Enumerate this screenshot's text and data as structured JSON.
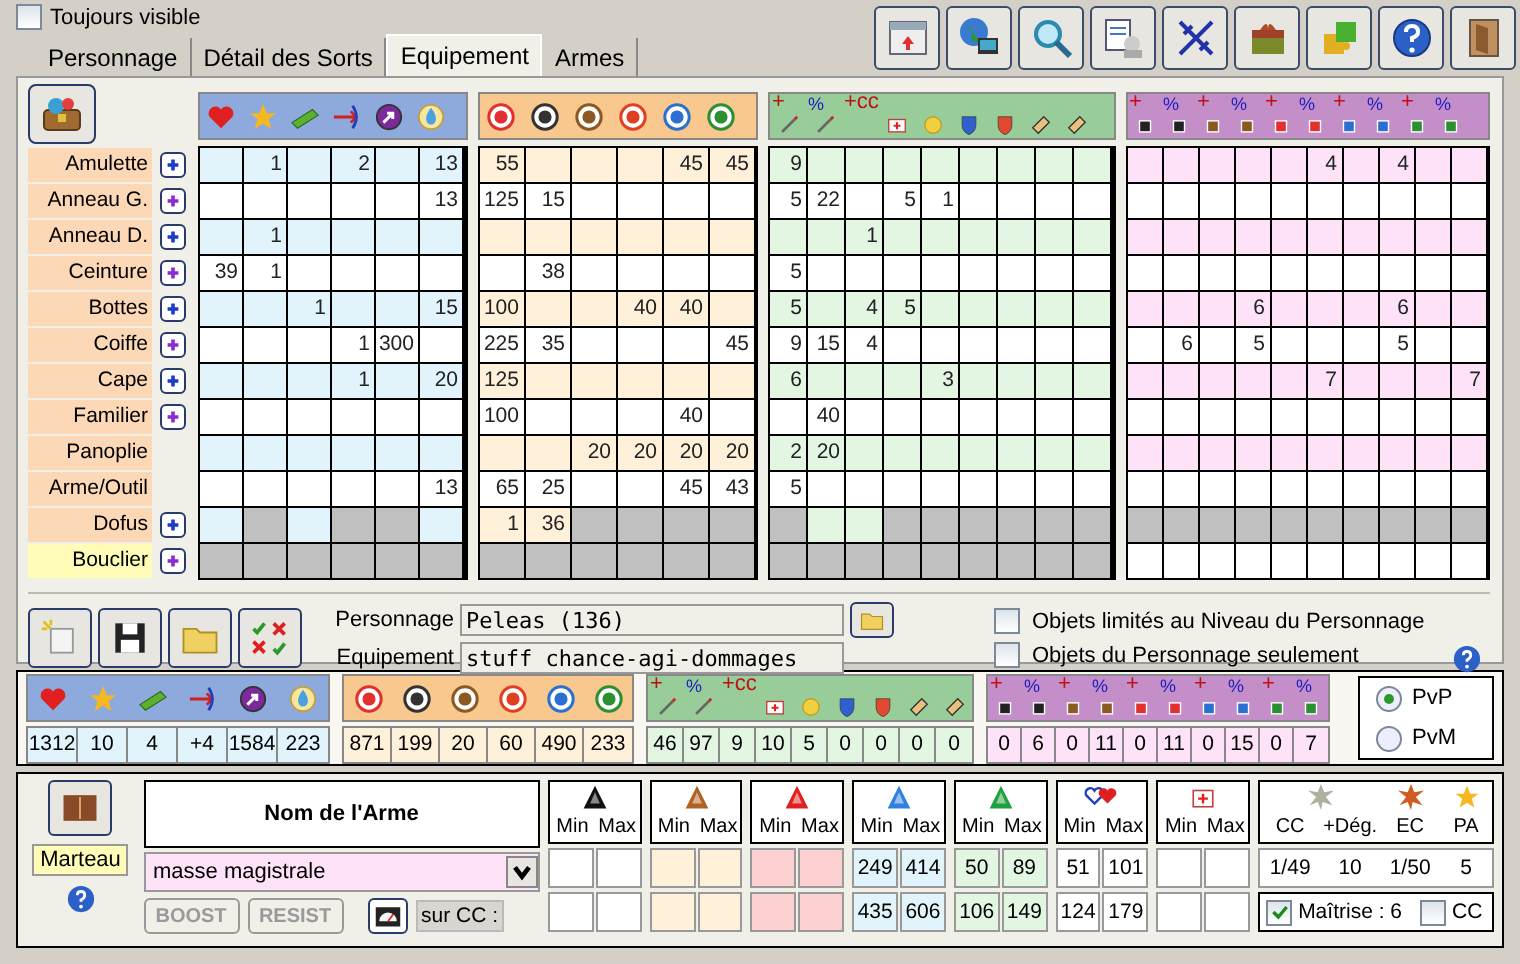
{
  "always_visible": {
    "label": "Toujours visible",
    "checked": false
  },
  "tabs": [
    {
      "label": "Personnage",
      "selected": false
    },
    {
      "label": "Détail des Sorts",
      "selected": false
    },
    {
      "label": "Equipement",
      "selected": true
    },
    {
      "label": "Armes",
      "selected": false
    }
  ],
  "equipment": {
    "signed_headers": [
      [
        "+",
        "%",
        "+cc"
      ],
      [
        "+",
        "%",
        "+",
        "%",
        "+",
        "%",
        "+",
        "%",
        "+",
        "%"
      ]
    ],
    "rows": [
      {
        "label": "Amulette",
        "selected": false,
        "add": true,
        "cells": [
          [
            null,
            "1",
            null,
            "2",
            null,
            "13"
          ],
          [
            "55",
            null,
            null,
            null,
            "45",
            "45"
          ],
          [
            "9",
            null,
            null,
            null,
            null,
            null,
            null,
            null,
            null
          ],
          [
            null,
            null,
            null,
            null,
            null,
            "4",
            null,
            "4",
            null,
            null
          ]
        ],
        "greyed": [
          [
            false,
            false,
            false,
            false,
            false,
            false
          ],
          [
            false,
            false,
            false,
            false,
            false,
            false
          ],
          [
            false,
            false,
            false,
            false,
            false,
            false,
            false,
            false,
            false
          ],
          [
            false,
            false,
            false,
            false,
            false,
            false,
            false,
            false,
            false,
            false
          ]
        ]
      },
      {
        "label": "Anneau G.",
        "selected": false,
        "add": true,
        "cells": [
          [
            null,
            null,
            null,
            null,
            null,
            "13"
          ],
          [
            "125",
            "15",
            null,
            null,
            null,
            null
          ],
          [
            "5",
            "22",
            null,
            "5",
            "1",
            null,
            null,
            null,
            null
          ],
          [
            null,
            null,
            null,
            null,
            null,
            null,
            null,
            null,
            null,
            null
          ]
        ],
        "greyed": [
          [
            false,
            false,
            false,
            false,
            false,
            false
          ],
          [
            false,
            false,
            false,
            false,
            false,
            false
          ],
          [
            false,
            false,
            false,
            false,
            false,
            false,
            false,
            false,
            false
          ],
          [
            false,
            false,
            false,
            false,
            false,
            false,
            false,
            false,
            false,
            false
          ]
        ]
      },
      {
        "label": "Anneau D.",
        "selected": false,
        "add": true,
        "cells": [
          [
            null,
            "1",
            null,
            null,
            null,
            null
          ],
          [
            null,
            null,
            null,
            null,
            null,
            null
          ],
          [
            null,
            null,
            "1",
            null,
            null,
            null,
            null,
            null,
            null
          ],
          [
            null,
            null,
            null,
            null,
            null,
            null,
            null,
            null,
            null,
            null
          ]
        ],
        "greyed": [
          [
            false,
            false,
            false,
            false,
            false,
            false
          ],
          [
            false,
            false,
            false,
            false,
            false,
            false
          ],
          [
            false,
            false,
            false,
            false,
            false,
            false,
            false,
            false,
            false
          ],
          [
            false,
            false,
            false,
            false,
            false,
            false,
            false,
            false,
            false,
            false
          ]
        ]
      },
      {
        "label": "Ceinture",
        "selected": false,
        "add": true,
        "cells": [
          [
            "39",
            "1",
            null,
            null,
            null,
            null
          ],
          [
            null,
            "38",
            null,
            null,
            null,
            null
          ],
          [
            "5",
            null,
            null,
            null,
            null,
            null,
            null,
            null,
            null
          ],
          [
            null,
            null,
            null,
            null,
            null,
            null,
            null,
            null,
            null,
            null
          ]
        ],
        "greyed": [
          [
            false,
            false,
            false,
            false,
            false,
            false
          ],
          [
            false,
            false,
            false,
            false,
            false,
            false
          ],
          [
            false,
            false,
            false,
            false,
            false,
            false,
            false,
            false,
            false
          ],
          [
            false,
            false,
            false,
            false,
            false,
            false,
            false,
            false,
            false,
            false
          ]
        ]
      },
      {
        "label": "Bottes",
        "selected": false,
        "add": true,
        "cells": [
          [
            null,
            null,
            "1",
            null,
            null,
            "15"
          ],
          [
            "100",
            null,
            null,
            "40",
            "40",
            null
          ],
          [
            "5",
            null,
            "4",
            "5",
            null,
            null,
            null,
            null,
            null
          ],
          [
            null,
            null,
            null,
            "6",
            null,
            null,
            null,
            "6",
            null,
            null
          ]
        ],
        "greyed": [
          [
            false,
            false,
            false,
            false,
            false,
            false
          ],
          [
            false,
            false,
            false,
            false,
            false,
            false
          ],
          [
            false,
            false,
            false,
            false,
            false,
            false,
            false,
            false,
            false
          ],
          [
            false,
            false,
            false,
            false,
            false,
            false,
            false,
            false,
            false,
            false
          ]
        ]
      },
      {
        "label": "Coiffe",
        "selected": false,
        "add": true,
        "cells": [
          [
            null,
            null,
            null,
            "1",
            "300",
            null
          ],
          [
            "225",
            "35",
            null,
            null,
            null,
            "45"
          ],
          [
            "9",
            "15",
            "4",
            null,
            null,
            null,
            null,
            null,
            null
          ],
          [
            null,
            "6",
            null,
            "5",
            null,
            null,
            null,
            "5",
            null,
            null
          ]
        ],
        "greyed": [
          [
            false,
            false,
            false,
            false,
            false,
            false
          ],
          [
            false,
            false,
            false,
            false,
            false,
            false
          ],
          [
            false,
            false,
            false,
            false,
            false,
            false,
            false,
            false,
            false
          ],
          [
            false,
            false,
            false,
            false,
            false,
            false,
            false,
            false,
            false,
            false
          ]
        ]
      },
      {
        "label": "Cape",
        "selected": false,
        "add": true,
        "cells": [
          [
            null,
            null,
            null,
            "1",
            null,
            "20"
          ],
          [
            "125",
            null,
            null,
            null,
            null,
            null
          ],
          [
            "6",
            null,
            null,
            null,
            "3",
            null,
            null,
            null,
            null
          ],
          [
            null,
            null,
            null,
            null,
            null,
            "7",
            null,
            null,
            null,
            "7"
          ]
        ],
        "greyed": [
          [
            false,
            false,
            false,
            false,
            false,
            false
          ],
          [
            false,
            false,
            false,
            false,
            false,
            false
          ],
          [
            false,
            false,
            false,
            false,
            false,
            false,
            false,
            false,
            false
          ],
          [
            false,
            false,
            false,
            false,
            false,
            false,
            false,
            false,
            false,
            false
          ]
        ]
      },
      {
        "label": "Familier",
        "selected": false,
        "add": true,
        "cells": [
          [
            null,
            null,
            null,
            null,
            null,
            null
          ],
          [
            "100",
            null,
            null,
            null,
            "40",
            null
          ],
          [
            null,
            "40",
            null,
            null,
            null,
            null,
            null,
            null,
            null
          ],
          [
            null,
            null,
            null,
            null,
            null,
            null,
            null,
            null,
            null,
            null
          ]
        ],
        "greyed": [
          [
            false,
            false,
            false,
            false,
            false,
            false
          ],
          [
            false,
            false,
            false,
            false,
            false,
            false
          ],
          [
            false,
            false,
            false,
            false,
            false,
            false,
            false,
            false,
            false
          ],
          [
            false,
            false,
            false,
            false,
            false,
            false,
            false,
            false,
            false,
            false
          ]
        ]
      },
      {
        "label": "Panoplie",
        "selected": false,
        "add": false,
        "cells": [
          [
            null,
            null,
            null,
            null,
            null,
            null
          ],
          [
            null,
            null,
            "20",
            "20",
            "20",
            "20"
          ],
          [
            "2",
            "20",
            null,
            null,
            null,
            null,
            null,
            null,
            null
          ],
          [
            null,
            null,
            null,
            null,
            null,
            null,
            null,
            null,
            null,
            null
          ]
        ],
        "greyed": [
          [
            false,
            false,
            false,
            false,
            false,
            false
          ],
          [
            false,
            false,
            false,
            false,
            false,
            false
          ],
          [
            false,
            false,
            false,
            false,
            false,
            false,
            false,
            false,
            false
          ],
          [
            false,
            false,
            false,
            false,
            false,
            false,
            false,
            false,
            false,
            false
          ]
        ]
      },
      {
        "label": "Arme/Outil",
        "selected": false,
        "add": false,
        "cells": [
          [
            null,
            null,
            null,
            null,
            null,
            "13"
          ],
          [
            "65",
            "25",
            null,
            null,
            "45",
            "43"
          ],
          [
            "5",
            null,
            null,
            null,
            null,
            null,
            null,
            null,
            null
          ],
          [
            null,
            null,
            null,
            null,
            null,
            null,
            null,
            null,
            null,
            null
          ]
        ],
        "greyed": [
          [
            false,
            false,
            false,
            false,
            false,
            false
          ],
          [
            false,
            false,
            false,
            false,
            false,
            false
          ],
          [
            false,
            false,
            false,
            false,
            false,
            false,
            false,
            false,
            false
          ],
          [
            false,
            false,
            false,
            false,
            false,
            false,
            false,
            false,
            false,
            false
          ]
        ]
      },
      {
        "label": "Dofus",
        "selected": false,
        "add": true,
        "cells": [
          [
            null,
            null,
            null,
            null,
            null,
            null
          ],
          [
            "1",
            "36",
            null,
            null,
            null,
            null
          ],
          [
            null,
            null,
            null,
            null,
            null,
            null,
            null,
            null,
            null
          ],
          [
            null,
            null,
            null,
            null,
            null,
            null,
            null,
            null,
            null,
            null
          ]
        ],
        "greyed": [
          [
            false,
            true,
            false,
            true,
            true,
            false
          ],
          [
            false,
            false,
            true,
            true,
            true,
            true
          ],
          [
            true,
            false,
            false,
            true,
            true,
            true,
            true,
            true,
            true
          ],
          [
            true,
            true,
            true,
            true,
            true,
            true,
            true,
            true,
            true,
            true
          ]
        ]
      },
      {
        "label": "Bouclier",
        "selected": true,
        "add": true,
        "cells": [
          [
            null,
            null,
            null,
            null,
            null,
            null
          ],
          [
            null,
            null,
            null,
            null,
            null,
            null
          ],
          [
            null,
            null,
            null,
            null,
            null,
            null,
            null,
            null,
            null
          ],
          [
            null,
            null,
            null,
            null,
            null,
            null,
            null,
            null,
            null,
            null
          ]
        ],
        "greyed": [
          [
            true,
            true,
            true,
            true,
            true,
            true
          ],
          [
            true,
            true,
            true,
            true,
            true,
            true
          ],
          [
            true,
            true,
            true,
            true,
            true,
            true,
            true,
            true,
            true
          ],
          [
            false,
            false,
            false,
            false,
            false,
            false,
            false,
            false,
            false,
            false
          ]
        ]
      }
    ]
  },
  "character": {
    "label": "Personnage",
    "value": "Peleas (136)"
  },
  "set": {
    "label": "Equipement",
    "value": "stuff chance-agi-dommages"
  },
  "filters": [
    {
      "label": "Objets limités au Niveau du Personnage",
      "checked": false
    },
    {
      "label": "Objets du Personnage seulement",
      "checked": false
    }
  ],
  "totals": {
    "signed_headers": [
      [
        "+",
        "%",
        "+cc"
      ],
      [
        "+",
        "%",
        "+",
        "%",
        "+",
        "%",
        "+",
        "%",
        "+",
        "%"
      ]
    ],
    "values": [
      [
        "1312",
        "10",
        "4",
        "+4",
        "1584",
        "223"
      ],
      [
        "871",
        "199",
        "20",
        "60",
        "490",
        "233"
      ],
      [
        "46",
        "97",
        "9",
        "10",
        "5",
        "0",
        "0",
        "0",
        "0"
      ],
      [
        "0",
        "6",
        "0",
        "11",
        "0",
        "11",
        "0",
        "15",
        "0",
        "7"
      ]
    ]
  },
  "mode": [
    {
      "label": "PvP",
      "selected": true
    },
    {
      "label": "PvM",
      "selected": false
    }
  ],
  "weapon": {
    "header": "Nom de l'Arme",
    "type": "Marteau",
    "name": "masse magistrale",
    "crit_label": "sur CC :",
    "boost": {
      "label": "BOOST",
      "disabled": true
    },
    "resist": {
      "label": "RESIST",
      "disabled": true
    },
    "damage": [
      {
        "min_label": "Min",
        "max_label": "Max"
      },
      {
        "min_label": "Min",
        "max_label": "Max"
      },
      {
        "min_label": "Min",
        "max_label": "Max"
      },
      {
        "min_label": "Min",
        "max_label": "Max",
        "normal": [
          "249",
          "414"
        ],
        "critical": [
          "435",
          "606"
        ]
      },
      {
        "min_label": "Min",
        "max_label": "Max",
        "normal": [
          "50",
          "89"
        ],
        "critical": [
          "106",
          "149"
        ]
      },
      {
        "min_label": "Min",
        "max_label": "Max",
        "normal": [
          "51",
          "101"
        ],
        "critical": [
          "124",
          "179"
        ]
      },
      {
        "min_label": "Min",
        "max_label": "Max"
      }
    ],
    "extras": [
      {
        "label": "CC",
        "value": "1/49"
      },
      {
        "label": "+Dég.",
        "value": "10"
      },
      {
        "label": "EC",
        "value": "1/50"
      },
      {
        "label": "PA",
        "value": "5"
      }
    ],
    "mastery": {
      "label": "Maîtrise : 6",
      "checked": true
    },
    "crit_toggle": {
      "label": "CC",
      "checked": false
    }
  }
}
